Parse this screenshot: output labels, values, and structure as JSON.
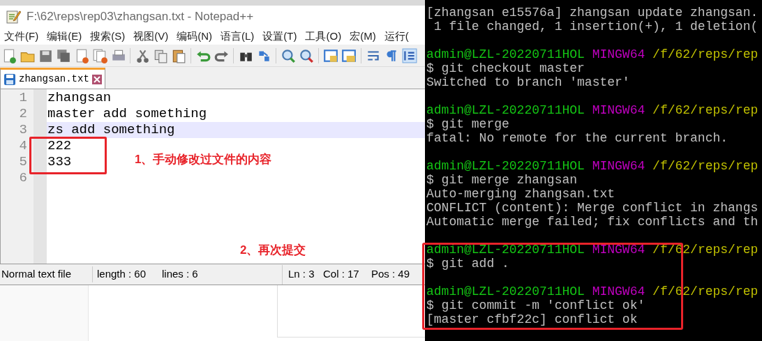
{
  "notepad": {
    "title": "F:\\62\\reps\\rep03\\zhangsan.txt - Notepad++",
    "menu": [
      "文件(F)",
      "编辑(E)",
      "搜索(S)",
      "视图(V)",
      "编码(N)",
      "语言(L)",
      "设置(T)",
      "工具(O)",
      "宏(M)",
      "运行("
    ],
    "tab": {
      "label": "zhangsan.txt",
      "selected": true
    },
    "lines": [
      {
        "number": "1",
        "text": "zhangsan",
        "current": false
      },
      {
        "number": "2",
        "text": "master add something",
        "current": false
      },
      {
        "number": "3",
        "text": "zs add something",
        "current": true
      },
      {
        "number": "4",
        "text": "222",
        "current": false
      },
      {
        "number": "5",
        "text": "333",
        "current": false
      },
      {
        "number": "6",
        "current": false
      }
    ],
    "status_bar": {
      "file_type": "Normal text file",
      "length": "length : 60",
      "lines": "lines : 6",
      "ln": "Ln : 3",
      "col": "Col : 17",
      "pos": "Pos : 49"
    }
  },
  "terminal": {
    "lines": [
      {
        "kind": "output",
        "text": "[zhangsan e15576a] zhangsan update zhangsan."
      },
      {
        "kind": "output",
        "text": " 1 file changed, 1 insertion(+), 1 deletion("
      },
      {
        "kind": "blank"
      },
      {
        "kind": "prompt",
        "user": "admin@LZL-20220711HOL",
        "system": "MINGW64",
        "path": "/f/62/reps/rep"
      },
      {
        "kind": "output",
        "text": "$ git checkout master"
      },
      {
        "kind": "output",
        "text": "Switched to branch 'master'"
      },
      {
        "kind": "blank"
      },
      {
        "kind": "prompt",
        "user": "admin@LZL-20220711HOL",
        "system": "MINGW64",
        "path": "/f/62/reps/rep"
      },
      {
        "kind": "output",
        "text": "$ git merge"
      },
      {
        "kind": "output",
        "text": "fatal: No remote for the current branch."
      },
      {
        "kind": "blank"
      },
      {
        "kind": "prompt",
        "user": "admin@LZL-20220711HOL",
        "system": "MINGW64",
        "path": "/f/62/reps/rep"
      },
      {
        "kind": "output",
        "text": "$ git merge zhangsan"
      },
      {
        "kind": "output",
        "text": "Auto-merging zhangsan.txt"
      },
      {
        "kind": "output",
        "text": "CONFLICT (content): Merge conflict in zhangs"
      },
      {
        "kind": "output",
        "text": "Automatic merge failed; fix conflicts and th"
      },
      {
        "kind": "blank"
      },
      {
        "kind": "prompt",
        "user": "admin@LZL-20220711HOL",
        "system": "MINGW64",
        "path": "/f/62/reps/rep"
      },
      {
        "kind": "output",
        "text": "$ git add ."
      },
      {
        "kind": "blank"
      },
      {
        "kind": "prompt",
        "user": "admin@LZL-20220711HOL",
        "system": "MINGW64",
        "path": "/f/62/reps/rep"
      },
      {
        "kind": "output",
        "text": "$ git commit -m 'conflict ok'"
      },
      {
        "kind": "output",
        "text": "[master cfbf22c] conflict ok"
      }
    ]
  },
  "annotations": [
    "1、手动修改过文件的内容",
    "2、再次提交"
  ]
}
